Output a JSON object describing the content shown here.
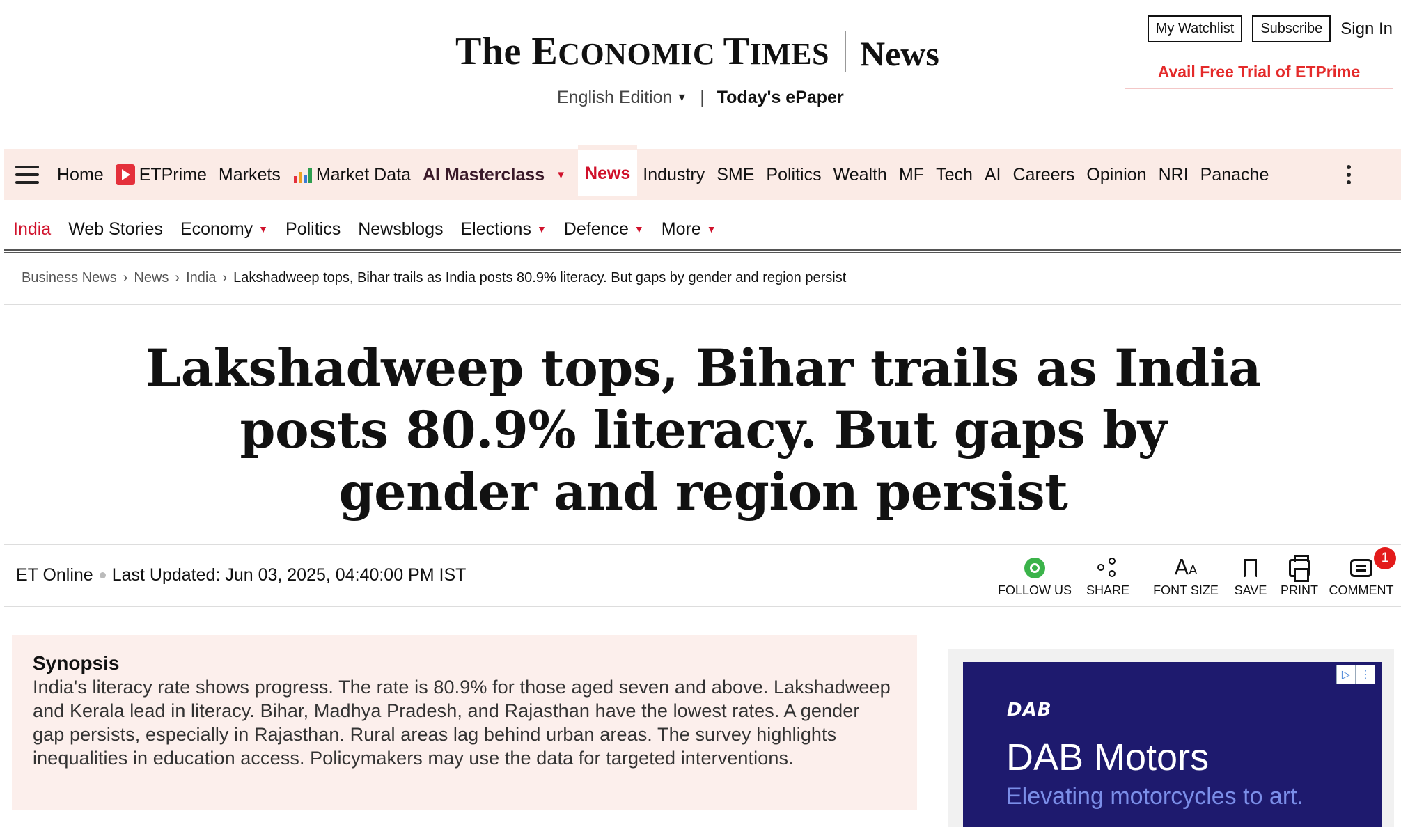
{
  "masthead": {
    "logo_part1": "The ",
    "logo_word1_cap": "E",
    "logo_word1_rest": "CONOMIC ",
    "logo_word2_cap": "T",
    "logo_word2_rest": "IMES",
    "section": "News",
    "edition": "English Edition",
    "edition_sep": "|",
    "epaper": "Today's ePaper"
  },
  "account": {
    "watchlist": "My Watchlist",
    "subscribe": "Subscribe",
    "signin": "Sign In",
    "trial": "Avail Free Trial of ETPrime"
  },
  "nav": {
    "items": [
      "Home",
      "ETPrime",
      "Markets",
      "Market Data",
      "AI Masterclass",
      "News",
      "Industry",
      "SME",
      "Politics",
      "Wealth",
      "MF",
      "Tech",
      "AI",
      "Careers",
      "Opinion",
      "NRI",
      "Panache"
    ],
    "active": "News"
  },
  "subnav": {
    "items": [
      "India",
      "Web Stories",
      "Economy",
      "Politics",
      "Newsblogs",
      "Elections",
      "Defence",
      "More"
    ],
    "active": "India"
  },
  "breadcrumb": {
    "items": [
      "Business News",
      "News",
      "India"
    ],
    "separator": "›",
    "current": "Lakshadweep tops, Bihar trails as India posts 80.9% literacy. But gaps by gender and region persist"
  },
  "article": {
    "headline": "Lakshadweep tops, Bihar trails as India posts 80.9% literacy. But gaps by gender and region persist",
    "author": "ET Online",
    "updated": "Last Updated: Jun 03, 2025, 04:40:00 PM IST"
  },
  "actions": {
    "follow": "FOLLOW US",
    "share": "SHARE",
    "font_size": "FONT SIZE",
    "save": "SAVE",
    "print": "PRINT",
    "comment": "COMMENT",
    "comment_count": "1",
    "font_glyph_big": "A",
    "font_glyph_small": "A"
  },
  "synopsis": {
    "title": "Synopsis",
    "body": "India's literacy rate shows progress. The rate is 80.9% for those aged seven and above. Lakshadweep and Kerala lead in literacy. Bihar, Madhya Pradesh, and Rajasthan have the lowest rates. A gender gap persists, especially in Rajasthan. Rural areas lag behind urban areas. The survey highlights inequalities in education access. Policymakers may use the data for targeted interventions."
  },
  "ad": {
    "logo": "DAB",
    "title": "DAB Motors",
    "tagline": "Elevating motorcycles to art.",
    "choices_play": "▷",
    "choices_more": "⋮"
  },
  "colors": {
    "brand_red": "#d0112b",
    "nav_bg": "#fbebe6",
    "synopsis_bg": "#fcefec",
    "ad_bg": "#1e1a6e"
  },
  "icons": {
    "hamburger": "hamburger-icon",
    "etprime": "etprime-play-icon",
    "market_data": "chart-icon",
    "kebab": "kebab-menu-icon",
    "whatsapp": "whatsapp-icon",
    "share": "share-icon",
    "font": "font-size-icon",
    "bookmark": "bookmark-icon",
    "print": "printer-icon",
    "comment": "comment-icon"
  }
}
